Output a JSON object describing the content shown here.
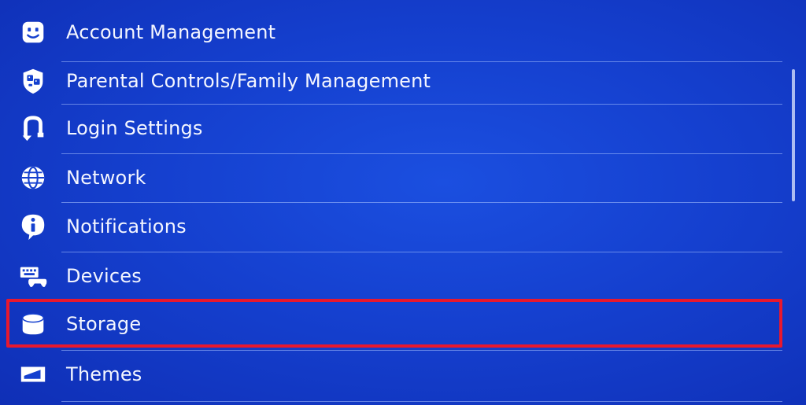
{
  "settings_menu": {
    "items": [
      {
        "id": "account",
        "label": "Account Management",
        "icon": "account-face-icon"
      },
      {
        "id": "parental",
        "label": "Parental Controls/Family Management",
        "icon": "family-shield-icon"
      },
      {
        "id": "login",
        "label": "Login Settings",
        "icon": "login-settings-icon"
      },
      {
        "id": "network",
        "label": "Network",
        "icon": "globe-icon"
      },
      {
        "id": "notifications",
        "label": "Notifications",
        "icon": "info-icon"
      },
      {
        "id": "devices",
        "label": "Devices",
        "icon": "keyboard-controller-icon"
      },
      {
        "id": "storage",
        "label": "Storage",
        "icon": "storage-disk-icon"
      },
      {
        "id": "themes",
        "label": "Themes",
        "icon": "themes-icon"
      }
    ],
    "highlighted_item": "Storage"
  },
  "colors": {
    "background": "#1540cf",
    "text": "#f4f6ff",
    "divider": "#aac3ff",
    "highlight_border": "#e8182e"
  }
}
